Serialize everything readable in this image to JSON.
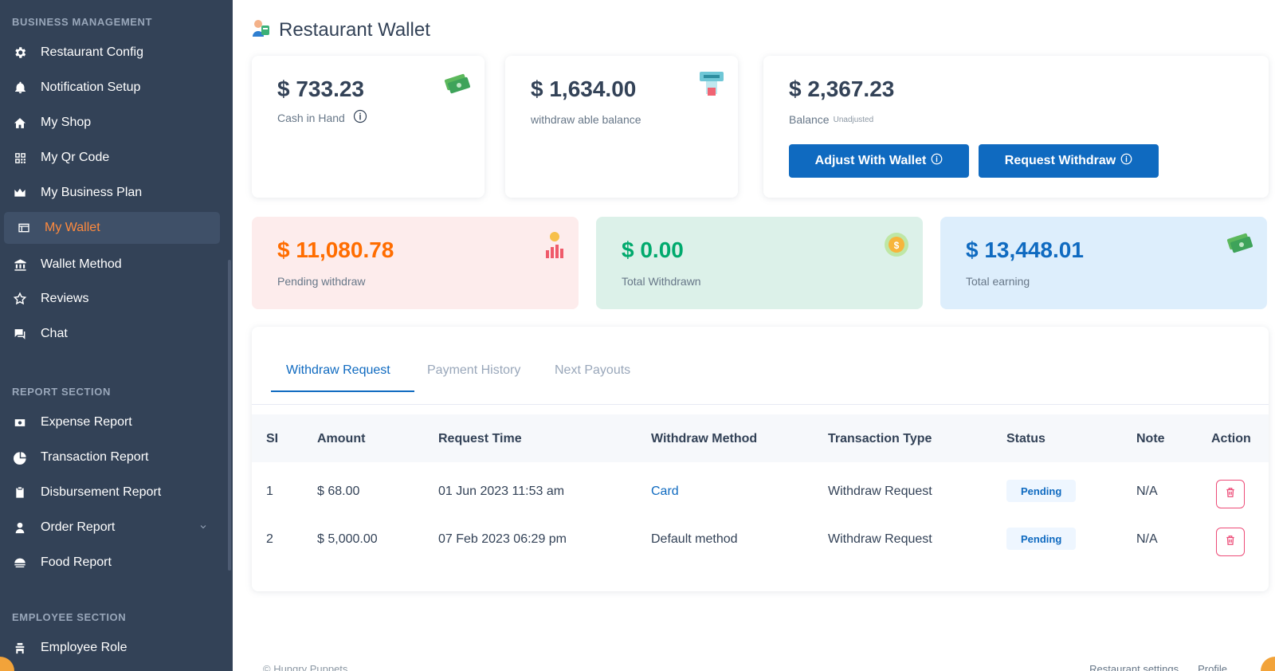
{
  "sidebar": {
    "sections": {
      "business": "BUSINESS MANAGEMENT",
      "report": "REPORT SECTION",
      "employee": "EMPLOYEE SECTION"
    },
    "items": {
      "restaurant_config": "Restaurant Config",
      "notification_setup": "Notification Setup",
      "my_shop": "My Shop",
      "my_qr_code": "My Qr Code",
      "my_business_plan": "My Business Plan",
      "my_wallet": "My Wallet",
      "wallet_method": "Wallet Method",
      "reviews": "Reviews",
      "chat": "Chat",
      "expense_report": "Expense Report",
      "transaction_report": "Transaction Report",
      "disbursement_report": "Disbursement Report",
      "order_report": "Order Report",
      "food_report": "Food Report",
      "employee_role": "Employee Role"
    }
  },
  "page": {
    "title": "Restaurant Wallet"
  },
  "wallet": {
    "cash_in_hand": {
      "amount": "$ 733.23",
      "label": "Cash in Hand"
    },
    "withdrawable": {
      "amount": "$ 1,634.00",
      "label": "withdraw able balance"
    },
    "balance": {
      "amount": "$ 2,367.23",
      "label": "Balance",
      "sub_label": "Unadjusted"
    },
    "adjust_button": "Adjust With Wallet",
    "request_button": "Request Withdraw"
  },
  "stats": {
    "pending": {
      "amount": "$ 11,080.78",
      "label": "Pending withdraw"
    },
    "withdrawn": {
      "amount": "$ 0.00",
      "label": "Total Withdrawn"
    },
    "earning": {
      "amount": "$ 13,448.01",
      "label": "Total earning"
    }
  },
  "colors": {
    "sidebar_bg": "#334257",
    "active": "#ff8a3d",
    "primary": "#0f6ac0",
    "pending_bg": "#fdecec",
    "pending_text": "#ff6d00",
    "withdrawn_bg": "#dcf1e9",
    "withdrawn_text": "#00aa6d",
    "earning_bg": "#ddeefc",
    "earning_text": "#0f6ac0",
    "danger": "#ed4c78"
  },
  "tabs": {
    "withdraw_request": "Withdraw Request",
    "payment_history": "Payment History",
    "next_payouts": "Next Payouts"
  },
  "table": {
    "headers": {
      "sl": "SI",
      "amount": "Amount",
      "request_time": "Request Time",
      "method": "Withdraw Method",
      "type": "Transaction Type",
      "status": "Status",
      "note": "Note",
      "action": "Action"
    },
    "rows": [
      {
        "sl": "1",
        "amount": "$ 68.00",
        "time": "01 Jun 2023 11:53 am",
        "method": "Card",
        "type": "Withdraw Request",
        "status": "Pending",
        "note": "N/A"
      },
      {
        "sl": "2",
        "amount": "$ 5,000.00",
        "time": "07 Feb 2023 06:29 pm",
        "method": "Default method",
        "type": "Withdraw Request",
        "status": "Pending",
        "note": "N/A"
      }
    ]
  },
  "footer": {
    "copyright": "© Hungry Puppets",
    "links": [
      "Restaurant settings",
      "Profile"
    ]
  }
}
